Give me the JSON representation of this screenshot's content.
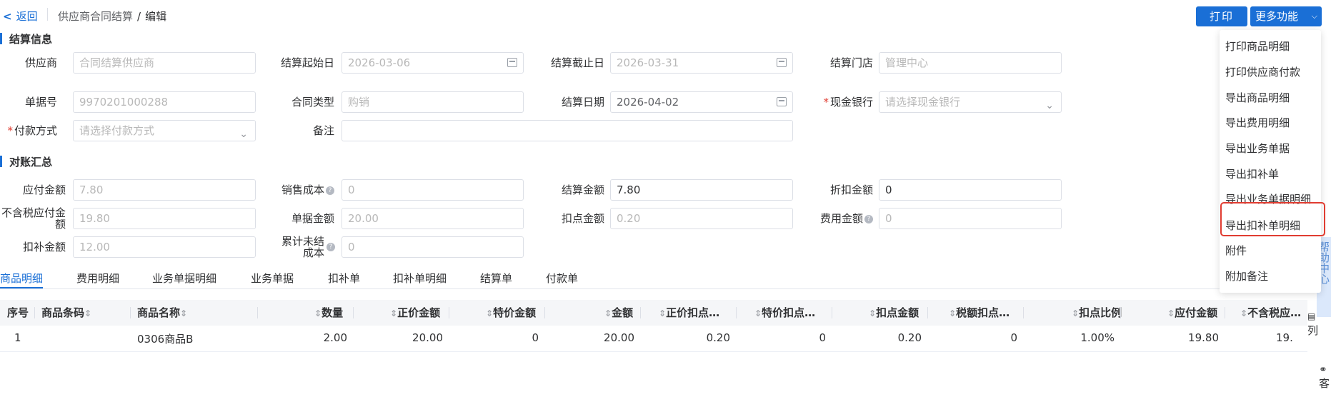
{
  "header": {
    "back_label": "返回",
    "crumb_parent": "供应商合同结算",
    "crumb_sep": "/",
    "crumb_current": "编辑",
    "print_label": "打印",
    "more_label": "更多功能"
  },
  "section_settle": {
    "title": "结算信息",
    "supplier_label": "供应商",
    "supplier_placeholder": "合同结算供应商",
    "start_label": "结算起始日",
    "start_value": "2026-03-06",
    "end_label": "结算截止日",
    "end_value": "2026-03-31",
    "store_label": "结算门店",
    "store_value": "管理中心",
    "docno_label": "单据号",
    "docno_value": "9970201000288",
    "contract_type_label": "合同类型",
    "contract_type_value": "购销",
    "settle_date_label": "结算日期",
    "settle_date_value": "2026-04-02",
    "cash_bank_label": "现金银行",
    "cash_bank_placeholder": "请选择现金银行",
    "pay_method_label": "付款方式",
    "pay_method_placeholder": "请选择付款方式",
    "remark_label": "备注",
    "remark_value": ""
  },
  "section_summary": {
    "title": "对账汇总",
    "payable_label": "应付金额",
    "payable_value": "7.80",
    "sales_cost_label": "销售成本",
    "sales_cost_value": "0",
    "settle_amount_label": "结算金额",
    "settle_amount_value": "7.80",
    "discount_label": "折扣金额",
    "discount_value": "0",
    "pretax_payable_label": "不含税应付金额",
    "pretax_payable_value": "19.80",
    "doc_amount_label": "单据金额",
    "doc_amount_value": "20.00",
    "point_amount_label": "扣点金额",
    "point_amount_value": "0.20",
    "fee_amount_label": "费用金额",
    "fee_amount_value": "0",
    "deduct_amount_label": "扣补金额",
    "deduct_amount_value": "12.00",
    "unsettled_cost_label": "累计未结成本",
    "unsettled_cost_value": "0"
  },
  "tabs": [
    "商品明细",
    "费用明细",
    "业务单据明细",
    "业务单据",
    "扣补单",
    "扣补单明细",
    "结算单",
    "付款单"
  ],
  "table": {
    "headers": [
      "序号",
      "商品条码",
      "商品名称",
      "数量",
      "正价金额",
      "特价金额",
      "金额",
      "正价扣点…",
      "特价扣点…",
      "扣点金额",
      "税额扣点…",
      "扣点比例",
      "应付金额",
      "不含税应…"
    ],
    "rows": [
      [
        "1",
        "",
        "0306商品B",
        "2.00",
        "20.00",
        "0",
        "20.00",
        "0.20",
        "0",
        "0.20",
        "0",
        "1.00%",
        "19.80",
        "19."
      ]
    ]
  },
  "dropdown": {
    "items": [
      "打印商品明细",
      "打印供应商付款",
      "导出商品明细",
      "导出费用明细",
      "导出业务单据",
      "导出扣补单",
      "导出业务单据明细",
      "导出扣补单明细",
      "附件",
      "附加备注"
    ],
    "highlighted_index": 7
  },
  "side": {
    "help_label": "帮助中心",
    "columns_label": "列",
    "service_label": "客"
  },
  "colors": {
    "accent": "#1a6fd6",
    "highlight": "#e03c31"
  }
}
